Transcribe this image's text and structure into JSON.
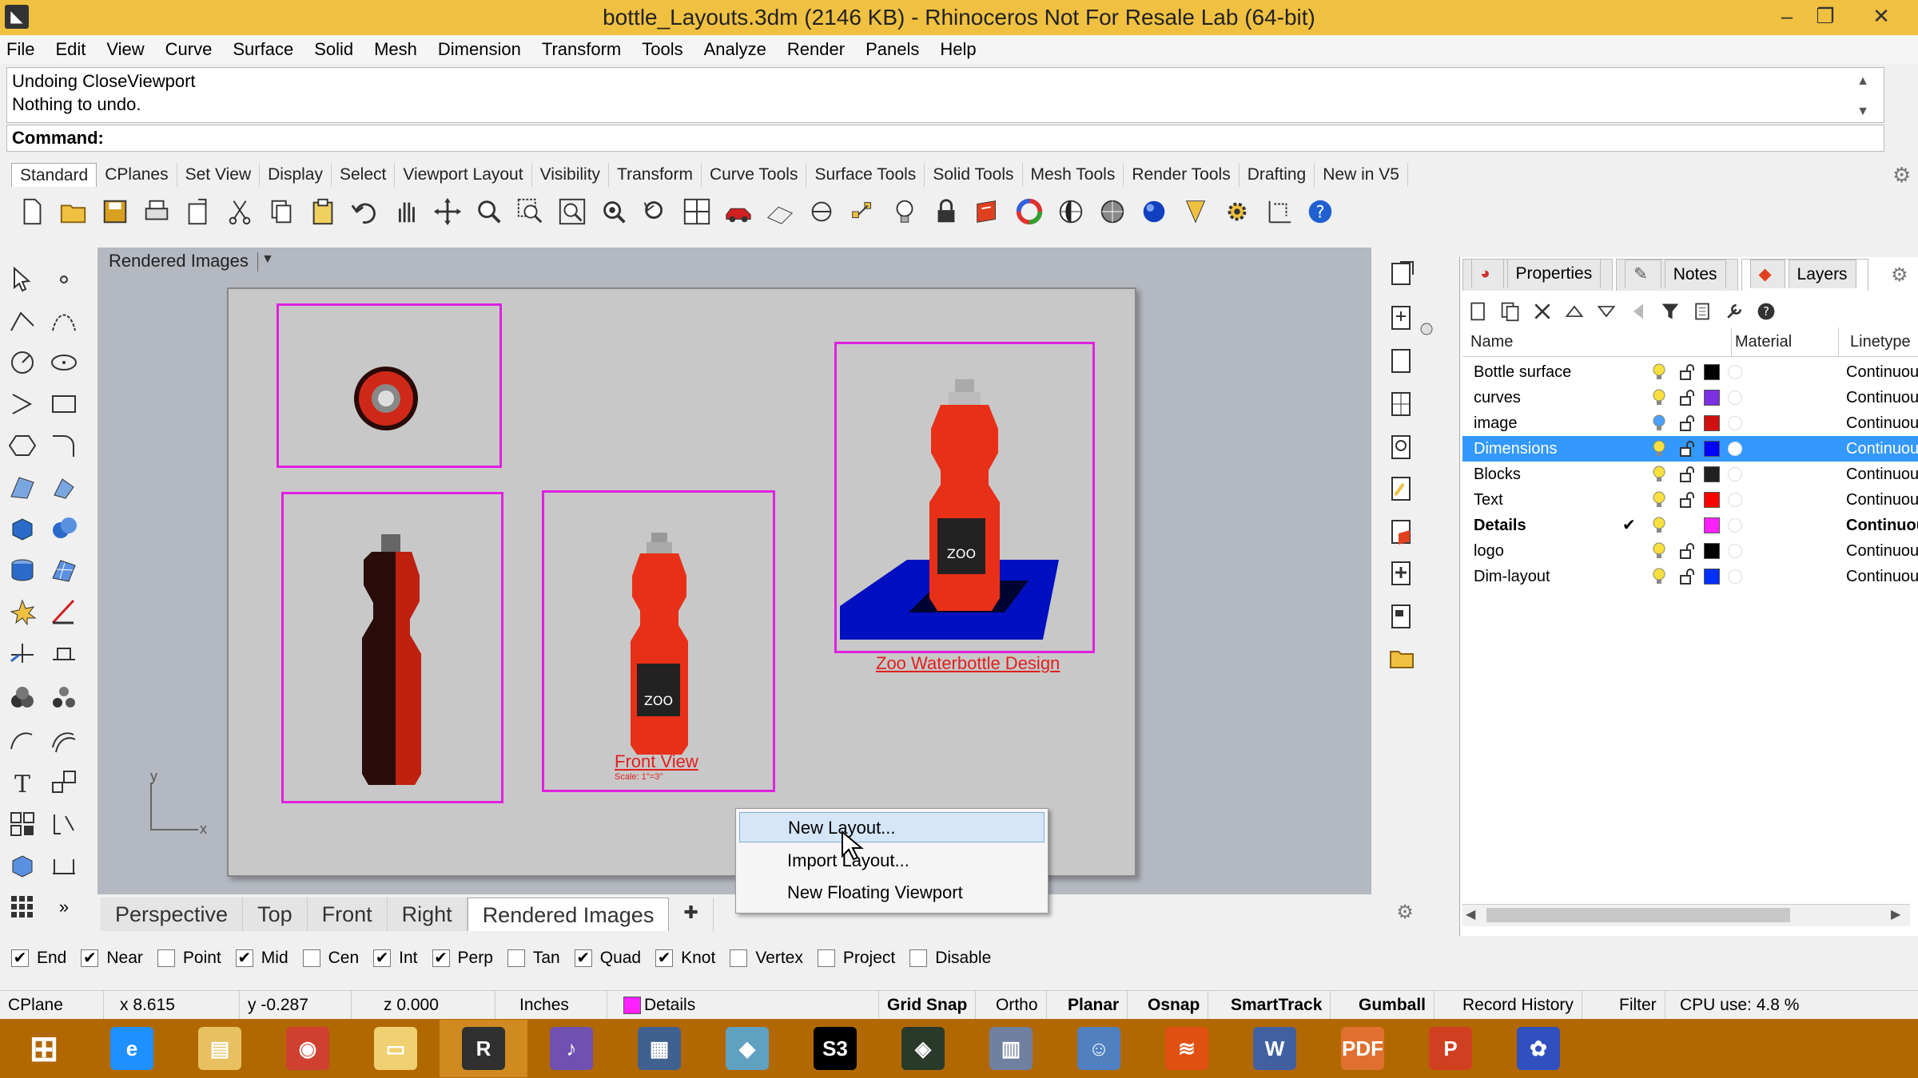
{
  "window": {
    "title": "bottle_Layouts.3dm (2146 KB) - Rhinoceros Not For Resale Lab (64-bit)",
    "minimize": "‒",
    "restore": "❐",
    "close": "✕"
  },
  "menu": [
    "File",
    "Edit",
    "View",
    "Curve",
    "Surface",
    "Solid",
    "Mesh",
    "Dimension",
    "Transform",
    "Tools",
    "Analyze",
    "Render",
    "Panels",
    "Help"
  ],
  "command": {
    "history": [
      "Undoing CloseViewport",
      "Nothing to undo."
    ],
    "prompt": "Command:"
  },
  "toolbar_tabs": [
    "Standard",
    "CPlanes",
    "Set View",
    "Display",
    "Select",
    "Viewport Layout",
    "Visibility",
    "Transform",
    "Curve Tools",
    "Surface Tools",
    "Solid Tools",
    "Mesh Tools",
    "Render Tools",
    "Drafting",
    "New in V5"
  ],
  "viewport": {
    "title": "Rendered Images",
    "captions": {
      "front_view": "Front View",
      "front_scale": "Scale: 1\"=3\"",
      "design_title": "Zoo Waterbottle Design"
    },
    "axis_y": "y",
    "axis_x": "x",
    "colors": {
      "detail_border": "#e020e0",
      "bottle": "#e83018",
      "plane": "#0010c0"
    }
  },
  "viewport_tabs": [
    "Perspective",
    "Top",
    "Front",
    "Right",
    "Rendered Images"
  ],
  "context_menu": {
    "items": [
      "New Layout...",
      "Import Layout...",
      "New Floating Viewport"
    ],
    "highlighted": "New Layout..."
  },
  "osnap": [
    {
      "label": "End",
      "checked": true
    },
    {
      "label": "Near",
      "checked": true
    },
    {
      "label": "Point",
      "checked": false
    },
    {
      "label": "Mid",
      "checked": true
    },
    {
      "label": "Cen",
      "checked": false
    },
    {
      "label": "Int",
      "checked": true
    },
    {
      "label": "Perp",
      "checked": true
    },
    {
      "label": "Tan",
      "checked": false
    },
    {
      "label": "Quad",
      "checked": true
    },
    {
      "label": "Knot",
      "checked": true
    },
    {
      "label": "Vertex",
      "checked": false
    },
    {
      "label": "Project",
      "checked": false
    },
    {
      "label": "Disable",
      "checked": false
    }
  ],
  "status": {
    "cplane": "CPlane",
    "x": "x 8.615",
    "y": "y -0.287",
    "z": "z 0.000",
    "units": "Inches",
    "layer": "Details",
    "grid_snap": "Grid Snap",
    "ortho": "Ortho",
    "planar": "Planar",
    "osnap": "Osnap",
    "smarttrack": "SmartTrack",
    "gumball": "Gumball",
    "record_history": "Record History",
    "filter": "Filter",
    "cpu": "CPU use: 4.8 %"
  },
  "panel": {
    "tabs": [
      "Properties",
      "Notes",
      "Layers"
    ],
    "active_tab": "Layers",
    "columns": {
      "name": "Name",
      "material": "Material",
      "linetype": "Linetype"
    },
    "layers": [
      {
        "name": "Bottle surface",
        "color": "#000000",
        "linetype": "Continuou",
        "current": false,
        "selected": false
      },
      {
        "name": "curves",
        "color": "#7a30e0",
        "linetype": "Continuou",
        "current": false,
        "selected": false
      },
      {
        "name": "image",
        "color": "#d01010",
        "linetype": "Continuou",
        "current": false,
        "selected": false
      },
      {
        "name": "Dimensions",
        "color": "#0000ff",
        "linetype": "Continuou",
        "current": false,
        "selected": true
      },
      {
        "name": "Blocks",
        "color": "#202020",
        "linetype": "Continuou",
        "current": false,
        "selected": false
      },
      {
        "name": "Text",
        "color": "#ff0000",
        "linetype": "Continuou",
        "current": false,
        "selected": false
      },
      {
        "name": "Details",
        "color": "#ff20ff",
        "linetype": "Continuou",
        "current": true,
        "selected": false
      },
      {
        "name": "logo",
        "color": "#000000",
        "linetype": "Continuou",
        "current": false,
        "selected": false
      },
      {
        "name": "Dim-layout",
        "color": "#0030ff",
        "linetype": "Continuou",
        "current": false,
        "selected": false
      }
    ],
    "checkmark": "✔"
  },
  "taskbar": {
    "apps": [
      {
        "name": "windows-start",
        "glyph": "⊞",
        "color": "#b26800"
      },
      {
        "name": "internet-explorer",
        "glyph": "e",
        "color": "#1e90ff"
      },
      {
        "name": "file-explorer",
        "glyph": "▤",
        "color": "#e8c060"
      },
      {
        "name": "chrome",
        "glyph": "◉",
        "color": "#d04030"
      },
      {
        "name": "folder",
        "glyph": "▭",
        "color": "#f0d070"
      },
      {
        "name": "rhino",
        "glyph": "R",
        "color": "#303030"
      },
      {
        "name": "premiere",
        "glyph": "♪",
        "color": "#7050b0"
      },
      {
        "name": "film",
        "glyph": "▦",
        "color": "#406090"
      },
      {
        "name": "paper",
        "glyph": "◆",
        "color": "#60a0c0"
      },
      {
        "name": "s3",
        "glyph": "S3",
        "color": "#000000"
      },
      {
        "name": "cube",
        "glyph": "◈",
        "color": "#2a3a2a"
      },
      {
        "name": "chart",
        "glyph": "▥",
        "color": "#7080a0"
      },
      {
        "name": "people",
        "glyph": "☺",
        "color": "#5080c0"
      },
      {
        "name": "audio",
        "glyph": "≋",
        "color": "#e05010"
      },
      {
        "name": "word",
        "glyph": "W",
        "color": "#4060a0"
      },
      {
        "name": "pdf",
        "glyph": "PDF",
        "color": "#e07030"
      },
      {
        "name": "powerpoint",
        "glyph": "P",
        "color": "#d04020"
      },
      {
        "name": "flower",
        "glyph": "✿",
        "color": "#3050c0"
      }
    ]
  }
}
